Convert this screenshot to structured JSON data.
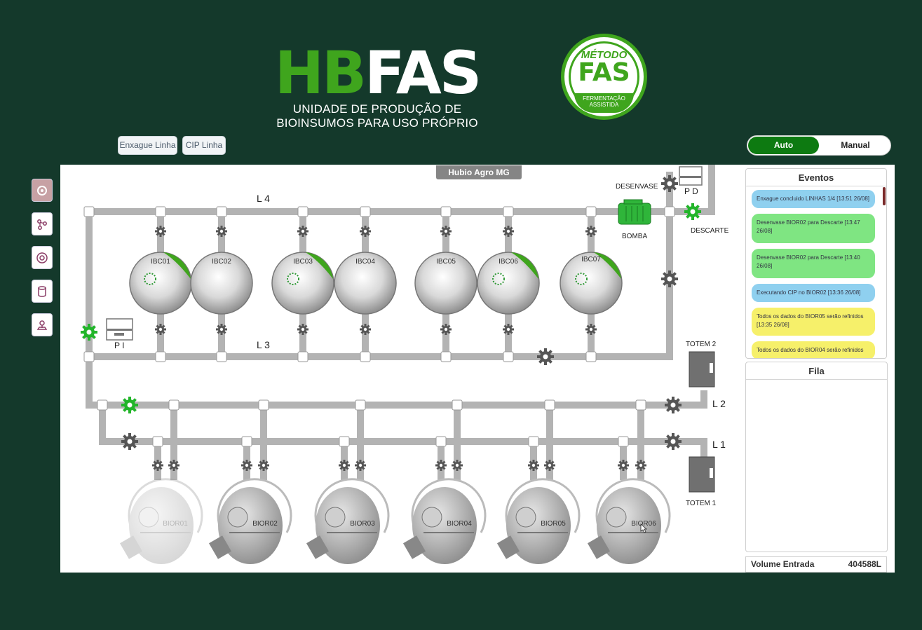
{
  "brand": {
    "logo_hb": "HB",
    "logo_fas": "FAS",
    "subtitle_line1": "UNIDADE DE PRODUÇÃO DE",
    "subtitle_line2": "BIOINSUMOS PARA USO PRÓPRIO",
    "seal_top": "MÉTODO",
    "seal_main": "FAS",
    "seal_band": "FERMENTAÇÃO ASSISTIDA"
  },
  "toolbar": {
    "rinse_label": "Enxague Linha",
    "cip_label": "CIP Linha"
  },
  "mode": {
    "auto_label": "Auto",
    "manual_label": "Manual",
    "selected": "Auto"
  },
  "plant": {
    "site_name": "Hubio Agro MG",
    "lines": {
      "l1": "L 1",
      "l2": "L 2",
      "l3": "L 3",
      "l4": "L 4"
    },
    "labels": {
      "desenvase": "DESENVASE",
      "pd": "P D",
      "descarte": "DESCARTE",
      "bomba": "BOMBA",
      "pi": "P I",
      "totem1": "TOTEM 1",
      "totem2": "TOTEM 2"
    },
    "ibcs": [
      "IBC01",
      "IBC02",
      "IBC03",
      "IBC04",
      "IBC05",
      "IBC06",
      "IBC07"
    ],
    "biors": [
      "BIOR01",
      "BIOR02",
      "BIOR03",
      "BIOR04",
      "BIOR05",
      "BIOR06"
    ]
  },
  "events": {
    "title": "Eventos",
    "items": [
      {
        "text": "Enxague concluido LINHAS 1/4 [13:51 26/08]",
        "color": "blue"
      },
      {
        "text": "Desenvase BIOR02 para Descarte [13:47 26/08]",
        "color": "green"
      },
      {
        "text": "Desenvase BIOR02 para Descarte [13:40 26/08]",
        "color": "green"
      },
      {
        "text": "Executando CIP no BIOR02 [13:36 26/08]",
        "color": "blue"
      },
      {
        "text": "Todos os dados do BIOR05 serão refinidos [13:35 26/08]",
        "color": "yellow"
      },
      {
        "text": "Todos os dados do BIOR04 serão refinidos",
        "color": "yellow"
      }
    ]
  },
  "queue": {
    "title": "Fila"
  },
  "volume": {
    "label": "Volume Entrada",
    "value": "404588L"
  },
  "colors": {
    "background": "#14392b",
    "brand_green": "#3fa51d",
    "valve_on": "#22b52a",
    "pipe": "#b3b3b3"
  }
}
